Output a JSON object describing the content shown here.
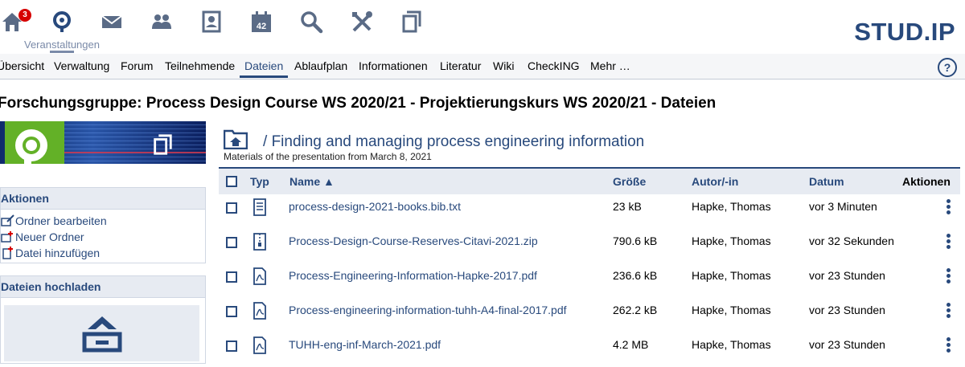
{
  "nav": {
    "badge_count": "3",
    "caption": "Veranstaltungen",
    "icons": [
      "home-icon",
      "courses-icon",
      "messages-icon",
      "community-icon",
      "profile-icon",
      "calendar-icon",
      "search-icon",
      "tools-icon",
      "files-icon"
    ],
    "calendar_day": "42"
  },
  "logo": {
    "text_left": "STUD",
    "dot": ".",
    "text_right": "IP"
  },
  "tabs": [
    "Übersicht",
    "Verwaltung",
    "Forum",
    "Teilnehmende",
    "Dateien",
    "Ablaufplan",
    "Informationen",
    "Literatur",
    "Wiki",
    "CheckING",
    "Mehr …"
  ],
  "active_tab": "Dateien",
  "help": "?",
  "page_title": "Forschungsgruppe: Process Design Course WS 2020/21 - Projektierungskurs WS 2020/21 - Dateien",
  "sidebar": {
    "actions_title": "Aktionen",
    "actions": [
      "Ordner bearbeiten",
      "Neuer Ordner",
      "Datei hinzufügen"
    ],
    "upload_title": "Dateien hochladen"
  },
  "folder": {
    "separator": "/",
    "title": "Finding and managing process engineering information",
    "description": "Materials of the presentation from March 8, 2021"
  },
  "table": {
    "headers": {
      "type": "Typ",
      "name": "Name",
      "sort_indicator": "▲",
      "size": "Größe",
      "author": "Autor/-in",
      "date": "Datum",
      "actions": "Aktionen"
    },
    "rows": [
      {
        "type": "text-file-icon",
        "name": "process-design-2021-books.bib.txt",
        "size": "23 kB",
        "author": "Hapke, Thomas",
        "date": "vor 3 Minuten"
      },
      {
        "type": "zip-file-icon",
        "name": "Process-Design-Course-Reserves-Citavi-2021.zip",
        "size": "790.6 kB",
        "author": "Hapke, Thomas",
        "date": "vor 32 Sekunden"
      },
      {
        "type": "pdf-file-icon",
        "name": "Process-Engineering-Information-Hapke-2017.pdf",
        "size": "236.6 kB",
        "author": "Hapke, Thomas",
        "date": "vor 23 Stunden"
      },
      {
        "type": "pdf-file-icon",
        "name": "Process-engineering-information-tuhh-A4-final-2017.pdf",
        "size": "262.2 kB",
        "author": "Hapke, Thomas",
        "date": "vor 23 Stunden"
      },
      {
        "type": "pdf-file-icon",
        "name": "TUHH-eng-inf-March-2021.pdf",
        "size": "4.2 MB",
        "author": "Hapke, Thomas",
        "date": "vor 23 Stunden"
      }
    ]
  },
  "colors": {
    "brand": "#28497c",
    "badge": "#d60000",
    "green": "#63b127",
    "icon_gray": "#5a6b86"
  }
}
